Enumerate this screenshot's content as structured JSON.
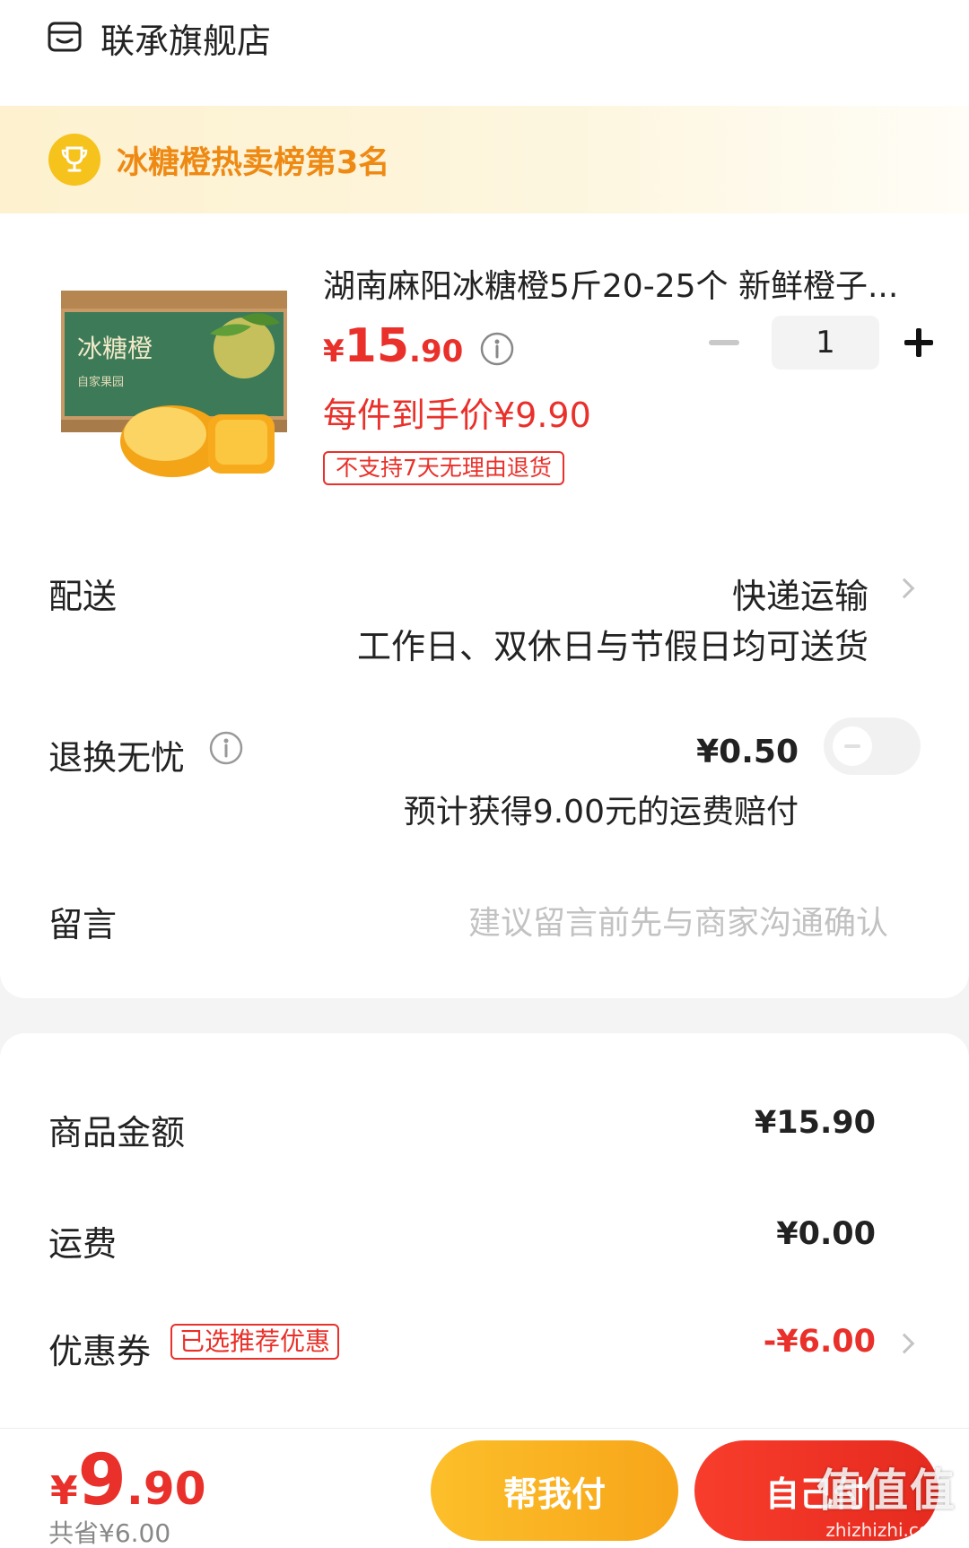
{
  "shop": {
    "name": "联承旗舰店",
    "icon": "shop-icon"
  },
  "rank": {
    "text": "冰糖橙热卖榜第3名",
    "icon": "trophy-icon"
  },
  "product": {
    "title": "湖南麻阳冰糖橙5斤20-25个 新鲜橙子...",
    "price_symbol": "¥",
    "price_int": "15",
    "price_dec": ".90",
    "final_price": "每件到手价¥9.90",
    "return_policy": "不支持7天无理由退货",
    "quantity": "1",
    "image": {
      "box_text": "冰糖橙",
      "box_subtext": "自家果园"
    }
  },
  "delivery": {
    "label": "配送",
    "value": "快递运输",
    "sub": "工作日、双休日与节假日均可送货"
  },
  "return_insurance": {
    "label": "退换无忧",
    "price": "¥0.50",
    "sub": "预计获得9.00元的运费赔付",
    "enabled": false
  },
  "message": {
    "label": "留言",
    "placeholder": "建议留言前先与商家沟通确认"
  },
  "summary": {
    "goods_label": "商品金额",
    "goods_value": "¥15.90",
    "shipping_label": "运费",
    "shipping_value": "¥0.00",
    "coupon_label": "优惠券",
    "coupon_badge": "已选推荐优惠",
    "coupon_value": "-¥6.00"
  },
  "footer": {
    "total_symbol": "¥",
    "total_int": "9",
    "total_dec": ".90",
    "saved": "共省¥6.00",
    "help_pay": "帮我付",
    "self_pay": "自己付"
  },
  "watermark": {
    "text": "值值值",
    "url": "zhizhizhi.com"
  },
  "colors": {
    "accent": "#e9302a",
    "gold": "#f6c21c",
    "orange_text": "#ee8a14"
  }
}
